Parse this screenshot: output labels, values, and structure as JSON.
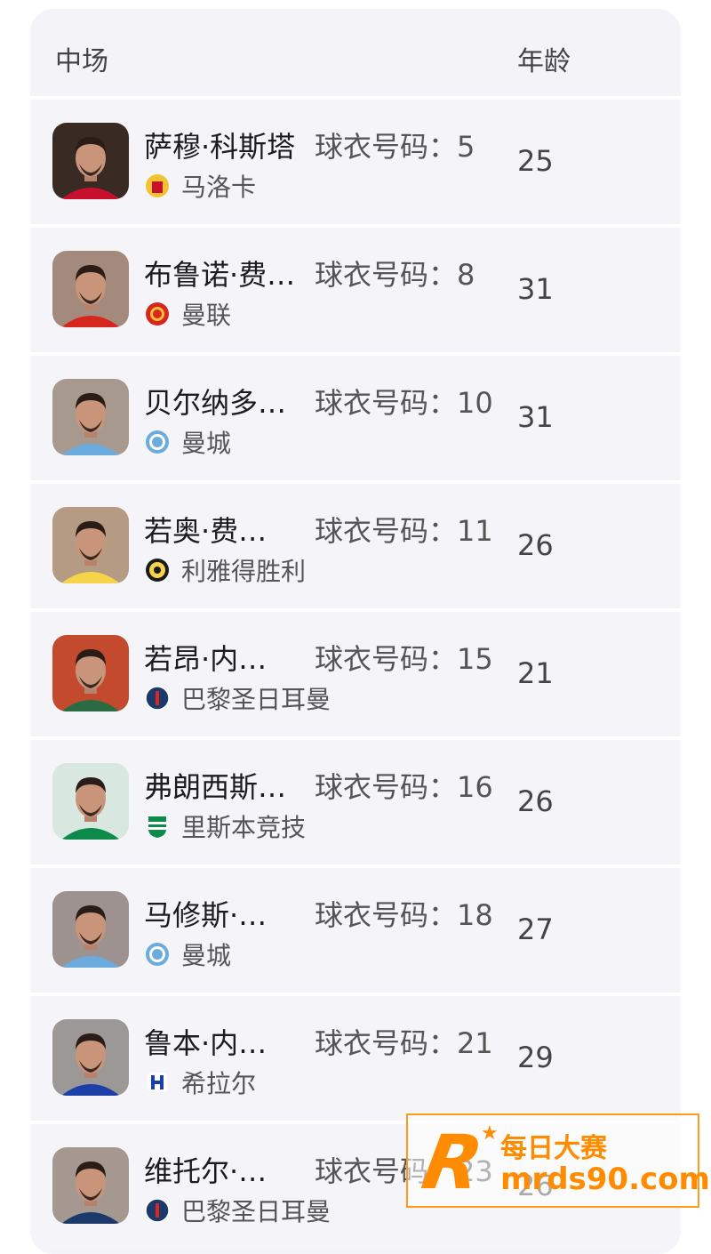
{
  "header": {
    "position_label": "中场",
    "age_label": "年龄"
  },
  "jersey_prefix": "球衣号码：",
  "players": [
    {
      "name": "萨穆·科斯塔",
      "number": "5",
      "club": "马洛卡",
      "age": "25",
      "avatar_color": "#3a2a24",
      "shirt_color": "#c8102e",
      "badge": "mallorca-badge-icon"
    },
    {
      "name": "布鲁诺·费…",
      "number": "8",
      "club": "曼联",
      "age": "31",
      "avatar_color": "#a48a7c",
      "shirt_color": "#d7261e",
      "badge": "manutd-badge-icon"
    },
    {
      "name": "贝尔纳多…",
      "number": "10",
      "club": "曼城",
      "age": "31",
      "avatar_color": "#a8998f",
      "shirt_color": "#6cabdd",
      "badge": "mancity-badge-icon"
    },
    {
      "name": "若奥·费…",
      "number": "11",
      "club": "利雅得胜利",
      "age": "26",
      "avatar_color": "#b59a84",
      "shirt_color": "#f6d44a",
      "badge": "alnassr-badge-icon"
    },
    {
      "name": "若昂·内…",
      "number": "15",
      "club": "巴黎圣日耳曼",
      "age": "21",
      "avatar_color": "#c44a2e",
      "shirt_color": "#2b6b44",
      "badge": "psg-badge-icon"
    },
    {
      "name": "弗朗西斯…",
      "number": "16",
      "club": "里斯本竞技",
      "age": "26",
      "avatar_color": "#d8e8e0",
      "shirt_color": "#0d8a4a",
      "badge": "sporting-badge-icon"
    },
    {
      "name": "马修斯·…",
      "number": "18",
      "club": "曼城",
      "age": "27",
      "avatar_color": "#9e9290",
      "shirt_color": "#6cabdd",
      "badge": "mancity-badge-icon"
    },
    {
      "name": "鲁本·内…",
      "number": "21",
      "club": "希拉尔",
      "age": "29",
      "avatar_color": "#9c9896",
      "shirt_color": "#1c3fa8",
      "badge": "alhilal-badge-icon"
    },
    {
      "name": "维托尔·…",
      "number": "23",
      "club": "巴黎圣日耳曼",
      "age": "26",
      "avatar_color": "#a49890",
      "shirt_color": "#1b3a6b",
      "badge": "psg-badge-icon"
    }
  ],
  "watermark": {
    "letter": "R",
    "title": "每日大赛",
    "url": "mrds90.com"
  }
}
